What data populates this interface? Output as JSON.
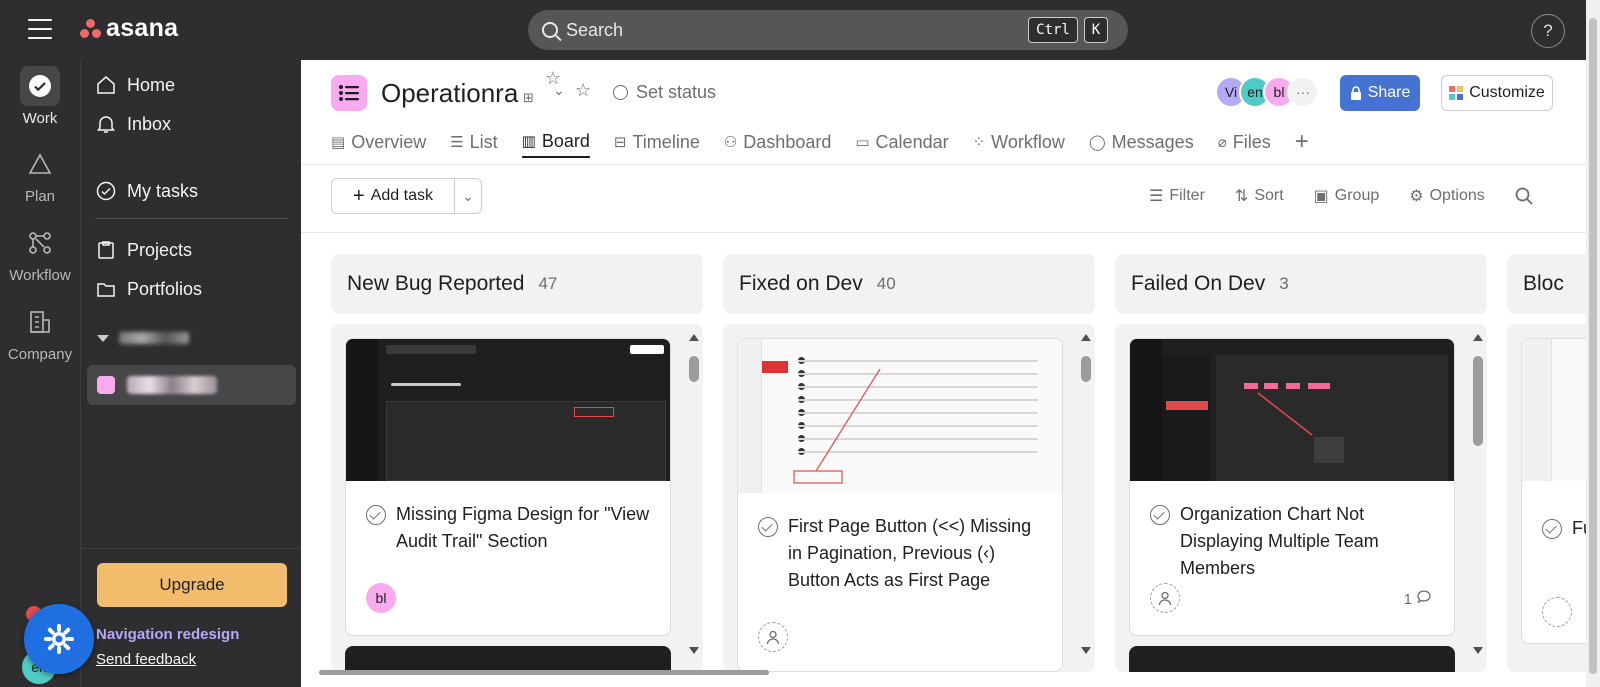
{
  "app": {
    "logo": "asana",
    "search_placeholder": "Search",
    "shortcut": [
      "Ctrl",
      "K"
    ],
    "help": "?"
  },
  "rail": [
    {
      "label": "Work",
      "icon": "check-circle-icon",
      "active": true
    },
    {
      "label": "Plan",
      "icon": "triangle-icon"
    },
    {
      "label": "Workflow",
      "icon": "workflow-icon"
    },
    {
      "label": "Company",
      "icon": "building-icon"
    }
  ],
  "sidebar": {
    "home": "Home",
    "inbox": "Inbox",
    "my_tasks": "My tasks",
    "projects": "Projects",
    "portfolios": "Portfolios",
    "upgrade": "Upgrade",
    "nav_redesign": "Navigation redesign",
    "send_feedback": "Send feedback",
    "user_initials": "en"
  },
  "project": {
    "title": "Operationra",
    "set_status": "Set status",
    "members": [
      {
        "initials": "Vi",
        "color": "#b4a9f5"
      },
      {
        "initials": "en",
        "color": "#4ecbc4"
      },
      {
        "initials": "bl",
        "color": "#f9aaef"
      }
    ],
    "more_members": "···",
    "share": "Share",
    "customize": "Customize"
  },
  "tabs": [
    {
      "label": "Overview",
      "icon": "overview-icon"
    },
    {
      "label": "List",
      "icon": "list-icon"
    },
    {
      "label": "Board",
      "icon": "board-icon",
      "active": true
    },
    {
      "label": "Timeline",
      "icon": "timeline-icon"
    },
    {
      "label": "Dashboard",
      "icon": "dashboard-icon"
    },
    {
      "label": "Calendar",
      "icon": "calendar-icon"
    },
    {
      "label": "Workflow",
      "icon": "workflow-icon"
    },
    {
      "label": "Messages",
      "icon": "message-icon"
    },
    {
      "label": "Files",
      "icon": "paperclip-icon"
    }
  ],
  "toolbar": {
    "add_task": "Add task",
    "filter": "Filter",
    "sort": "Sort",
    "group": "Group",
    "options": "Options"
  },
  "columns": [
    {
      "name": "New Bug Reported",
      "count": "47",
      "card": {
        "title": "Missing Figma Design for \"View Audit Trail\" Section",
        "assignee": "bl",
        "comments": ""
      }
    },
    {
      "name": "Fixed on Dev",
      "count": "40",
      "card": {
        "title": "First Page Button (<<) Missing in Pagination, Previous (‹) Button Acts as First Page",
        "assignee": "",
        "comments": ""
      }
    },
    {
      "name": "Failed On Dev",
      "count": "3",
      "card": {
        "title": "Organization Chart Not Displaying Multiple Team Members",
        "assignee": "",
        "comments": "1"
      }
    },
    {
      "name": "Bloc",
      "count": "",
      "card": {
        "title": "Fu",
        "assignee": "",
        "comments": ""
      }
    }
  ],
  "colors": {
    "topbar": "#2e2e30",
    "accent_blue": "#4573d2",
    "project_pink": "#f9aaef",
    "upgrade": "#f1bd6c",
    "nav_redesign": "#b4a9f5",
    "fab": "#1f6fe3"
  }
}
